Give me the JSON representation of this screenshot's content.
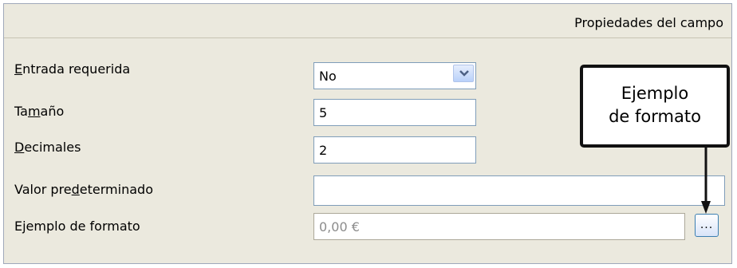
{
  "header": {
    "title": "Propiedades del campo"
  },
  "properties": [
    {
      "label_pre": "",
      "label_key": "E",
      "label_post": "ntrada requerida",
      "value": "No"
    },
    {
      "label_pre": "Ta",
      "label_key": "m",
      "label_post": "año",
      "value": "5"
    },
    {
      "label_pre": "",
      "label_key": "D",
      "label_post": "ecimales",
      "value": "2"
    },
    {
      "label_pre": "Valor pre",
      "label_key": "d",
      "label_post": "eterminado",
      "value": ""
    },
    {
      "label_pre": "Ejemplo de formato",
      "label_key": "",
      "label_post": "",
      "value": "0,00 €"
    }
  ],
  "browse_button": {
    "label": "..."
  },
  "callout": {
    "line1": "Ejemplo",
    "line2": "de formato"
  },
  "colors": {
    "panel_bg": "#ebe9de",
    "field_border": "#7f9db9",
    "callout_border": "#111111"
  },
  "icons": {
    "dropdown": "chevron-down-icon"
  }
}
